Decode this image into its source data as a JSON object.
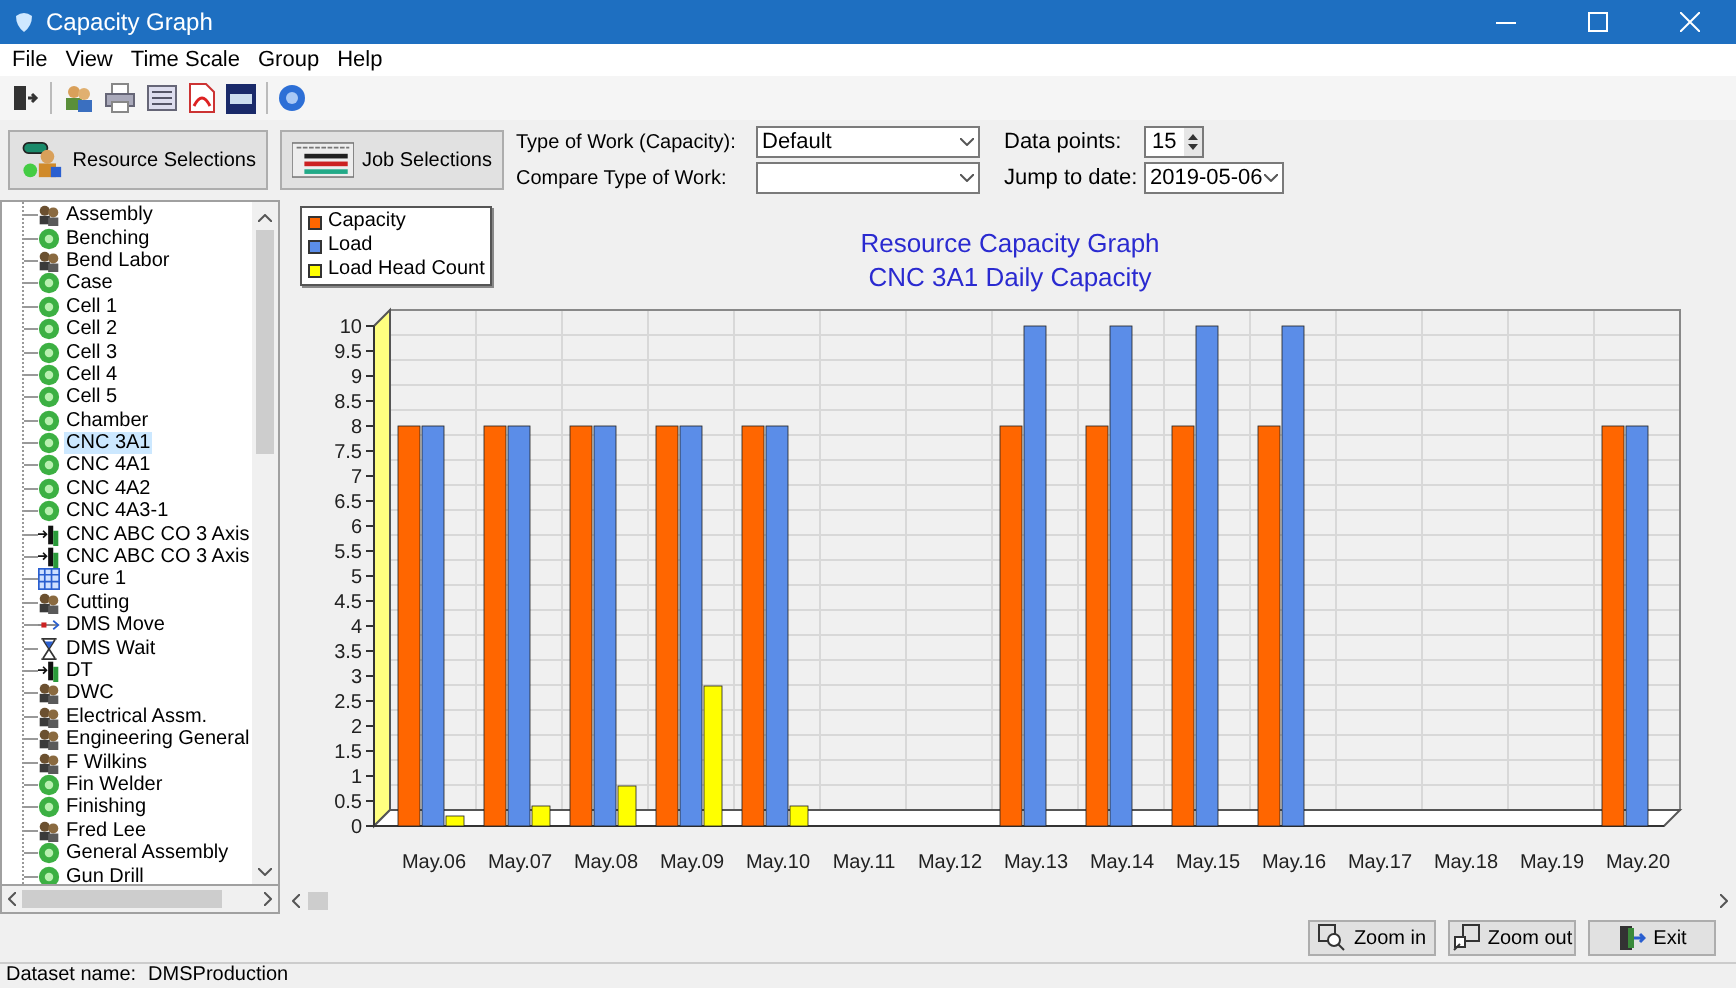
{
  "window": {
    "title": "Capacity Graph"
  },
  "menu": [
    "File",
    "View",
    "Time Scale",
    "Group",
    "Help"
  ],
  "selection_buttons": [
    {
      "kind": "resource",
      "label": "Resource Selections"
    },
    {
      "kind": "job",
      "label": "Job Selections"
    }
  ],
  "work_fields": [
    {
      "label": "Type of Work (Capacity):",
      "value": "Default"
    },
    {
      "label": "Compare Type of Work:"
    }
  ],
  "data_points": {
    "label": "Data points:",
    "value": "15"
  },
  "jump_to_date": {
    "label": "Jump to date:",
    "value": "2019-05-06"
  },
  "resources": [
    {
      "label": "Assembly",
      "kind": "group",
      "selected": false
    },
    {
      "label": "Benching",
      "kind": "resource",
      "selected": false
    },
    {
      "label": "Bend Labor",
      "kind": "group",
      "selected": false
    },
    {
      "label": "Case",
      "kind": "resource",
      "selected": false
    },
    {
      "label": "Cell 1",
      "kind": "resource",
      "selected": false
    },
    {
      "label": "Cell 2",
      "kind": "resource",
      "selected": false
    },
    {
      "label": "Cell 3",
      "kind": "resource",
      "selected": false
    },
    {
      "label": "Cell 4",
      "kind": "resource",
      "selected": false
    },
    {
      "label": "Cell 5",
      "kind": "resource",
      "selected": false
    },
    {
      "label": "Chamber",
      "kind": "resource",
      "selected": false
    },
    {
      "label": "CNC 3A1",
      "kind": "resource",
      "selected": true
    },
    {
      "label": "CNC 4A1",
      "kind": "resource",
      "selected": false
    },
    {
      "label": "CNC 4A2",
      "kind": "resource",
      "selected": false
    },
    {
      "label": "CNC 4A3-1",
      "kind": "resource",
      "selected": false
    },
    {
      "label": "CNC ABC CO 3 Axis",
      "kind": "machine",
      "selected": false
    },
    {
      "label": "CNC ABC CO 3 Axis",
      "kind": "machine",
      "selected": false
    },
    {
      "label": "Cure 1",
      "kind": "calendar",
      "selected": false
    },
    {
      "label": "Cutting",
      "kind": "group",
      "selected": false
    },
    {
      "label": "DMS Move",
      "kind": "move",
      "selected": false
    },
    {
      "label": "DMS Wait",
      "kind": "wait",
      "selected": false
    },
    {
      "label": "DT",
      "kind": "machine",
      "selected": false
    },
    {
      "label": "DWC",
      "kind": "group",
      "selected": false
    },
    {
      "label": "Electrical Assm.",
      "kind": "group",
      "selected": false
    },
    {
      "label": "Engineering General",
      "kind": "group",
      "selected": false
    },
    {
      "label": "F Wilkins",
      "kind": "group",
      "selected": false
    },
    {
      "label": "Fin Welder",
      "kind": "resource",
      "selected": false
    },
    {
      "label": "Finishing",
      "kind": "resource",
      "selected": false
    },
    {
      "label": "Fred Lee",
      "kind": "group",
      "selected": false
    },
    {
      "label": "General Assembly",
      "kind": "resource",
      "selected": false
    },
    {
      "label": "Gun Drill",
      "kind": "resource",
      "selected": false
    }
  ],
  "chart": {
    "subtitle": "CNC 3A1 Daily Capacity",
    "chart_data": {
      "type": "bar",
      "title": "Resource Capacity Graph",
      "categories": [
        "May.06",
        "May.07",
        "May.08",
        "May.09",
        "May.10",
        "May.11",
        "May.12",
        "May.13",
        "May.14",
        "May.15",
        "May.16",
        "May.17",
        "May.18",
        "May.19",
        "May.20"
      ],
      "series": [
        {
          "name": "Capacity",
          "color": "#ff6600",
          "values": [
            8,
            8,
            8,
            8,
            8,
            0,
            0,
            8,
            8,
            8,
            8,
            0,
            0,
            0,
            8
          ]
        },
        {
          "name": "Load",
          "color": "#5b8de8",
          "values": [
            8,
            8,
            8,
            8,
            8,
            0,
            0,
            10,
            10,
            10,
            10,
            0,
            0,
            0,
            8
          ]
        },
        {
          "name": "Load Head Count",
          "color": "#ffff00",
          "values": [
            0.2,
            0.4,
            0.8,
            2.8,
            0.4,
            0,
            0,
            0,
            0,
            0,
            0,
            0,
            0,
            0,
            0
          ]
        }
      ],
      "ylim": [
        0,
        10
      ],
      "yticks": [
        0,
        0.5,
        1,
        1.5,
        2,
        2.5,
        3,
        3.5,
        4,
        4.5,
        5,
        5.5,
        6,
        6.5,
        7,
        7.5,
        8,
        8.5,
        9,
        9.5,
        10
      ]
    }
  },
  "footer_buttons": [
    {
      "kind": "zoom_in",
      "label": "Zoom in"
    },
    {
      "kind": "zoom_out",
      "label": "Zoom out"
    },
    {
      "kind": "exit",
      "label": "Exit"
    }
  ],
  "status_bar": {
    "label": "Dataset name:",
    "value": "DMSProduction"
  }
}
